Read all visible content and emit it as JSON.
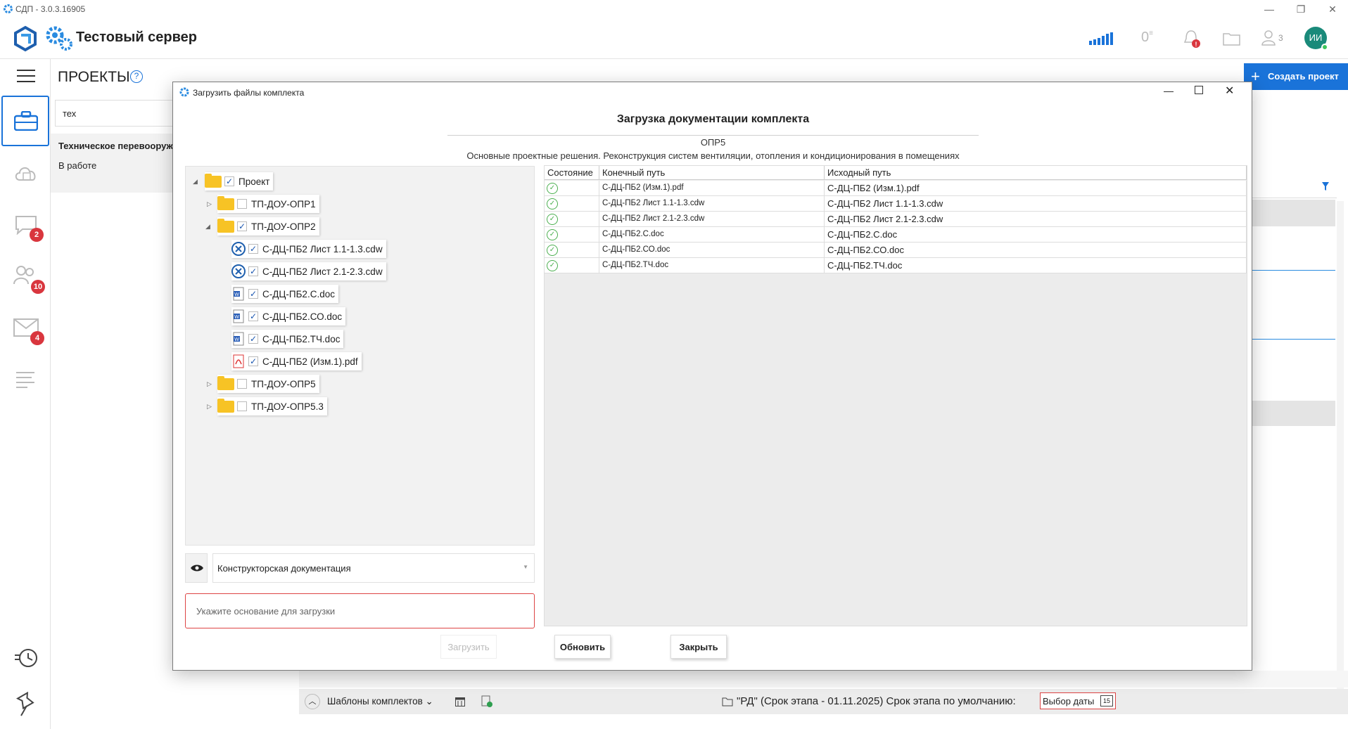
{
  "window": {
    "title": "СДП - 3.0.3.16905"
  },
  "header": {
    "server_name": "Тестовый сервер",
    "counter_zero": "0",
    "users_count": "3",
    "avatar_initials": "ИИ"
  },
  "rail": {
    "badges": {
      "chat": "2",
      "team": "10",
      "mail": "4"
    }
  },
  "projects": {
    "heading": "ПРОЕКТЫ",
    "help": "?",
    "search_value": "тех",
    "item_title": "Техническое перевооруж",
    "item_status": "В работе"
  },
  "create_button": "Создать проект",
  "dialog": {
    "title": "Загрузить файлы комплекта",
    "heading": "Загрузка документации комплекта",
    "code": "ОПР5",
    "description": "Основные проектные решения. Реконструкция систем вентиляции, отопления и кондиционирования в помещениях",
    "tree": {
      "root": "Проект",
      "folders": [
        "ТП-ДОУ-ОПР1",
        "ТП-ДОУ-ОПР2",
        "ТП-ДОУ-ОПР5",
        "ТП-ДОУ-ОПР5.3"
      ],
      "files": [
        "С-ДЦ-ПБ2 Лист 1.1-1.3.cdw",
        "С-ДЦ-ПБ2 Лист 2.1-2.3.cdw",
        "С-ДЦ-ПБ2.С.doc",
        "С-ДЦ-ПБ2.СО.doc",
        "С-ДЦ-ПБ2.ТЧ.doc",
        "С-ДЦ-ПБ2 (Изм.1).pdf"
      ]
    },
    "table": {
      "headers": [
        "Состояние",
        "Конечный путь",
        "Исходный путь"
      ],
      "rows": [
        {
          "dest": "С-ДЦ-ПБ2 (Изм.1).pdf",
          "src": "С-ДЦ-ПБ2 (Изм.1).pdf"
        },
        {
          "dest": "С-ДЦ-ПБ2 Лист 1.1-1.3.cdw",
          "src": "С-ДЦ-ПБ2 Лист 1.1-1.3.cdw"
        },
        {
          "dest": "С-ДЦ-ПБ2 Лист 2.1-2.3.cdw",
          "src": "С-ДЦ-ПБ2 Лист 2.1-2.3.cdw"
        },
        {
          "dest": "С-ДЦ-ПБ2.С.doc",
          "src": "С-ДЦ-ПБ2.С.doc"
        },
        {
          "dest": "С-ДЦ-ПБ2.СО.doc",
          "src": "С-ДЦ-ПБ2.СО.doc"
        },
        {
          "dest": "С-ДЦ-ПБ2.ТЧ.doc",
          "src": "С-ДЦ-ПБ2.ТЧ.doc"
        }
      ]
    },
    "doc_type": "Конструкторская документация",
    "reason_placeholder": "Укажите основание для загрузки",
    "buttons": {
      "upload": "Загрузить",
      "refresh": "Обновить",
      "close": "Закрыть"
    }
  },
  "statusbar": {
    "templates": "Шаблоны комплектов",
    "stage": "\"РД\" (Срок этапа - 01.11.2025) Срок этапа по умолчанию:",
    "date_pick": "Выбор даты",
    "cal_day": "15"
  },
  "colors": {
    "accent": "#1a73d9",
    "badge": "#d9363e",
    "folder": "#f7c325",
    "ok": "#4caf50"
  }
}
